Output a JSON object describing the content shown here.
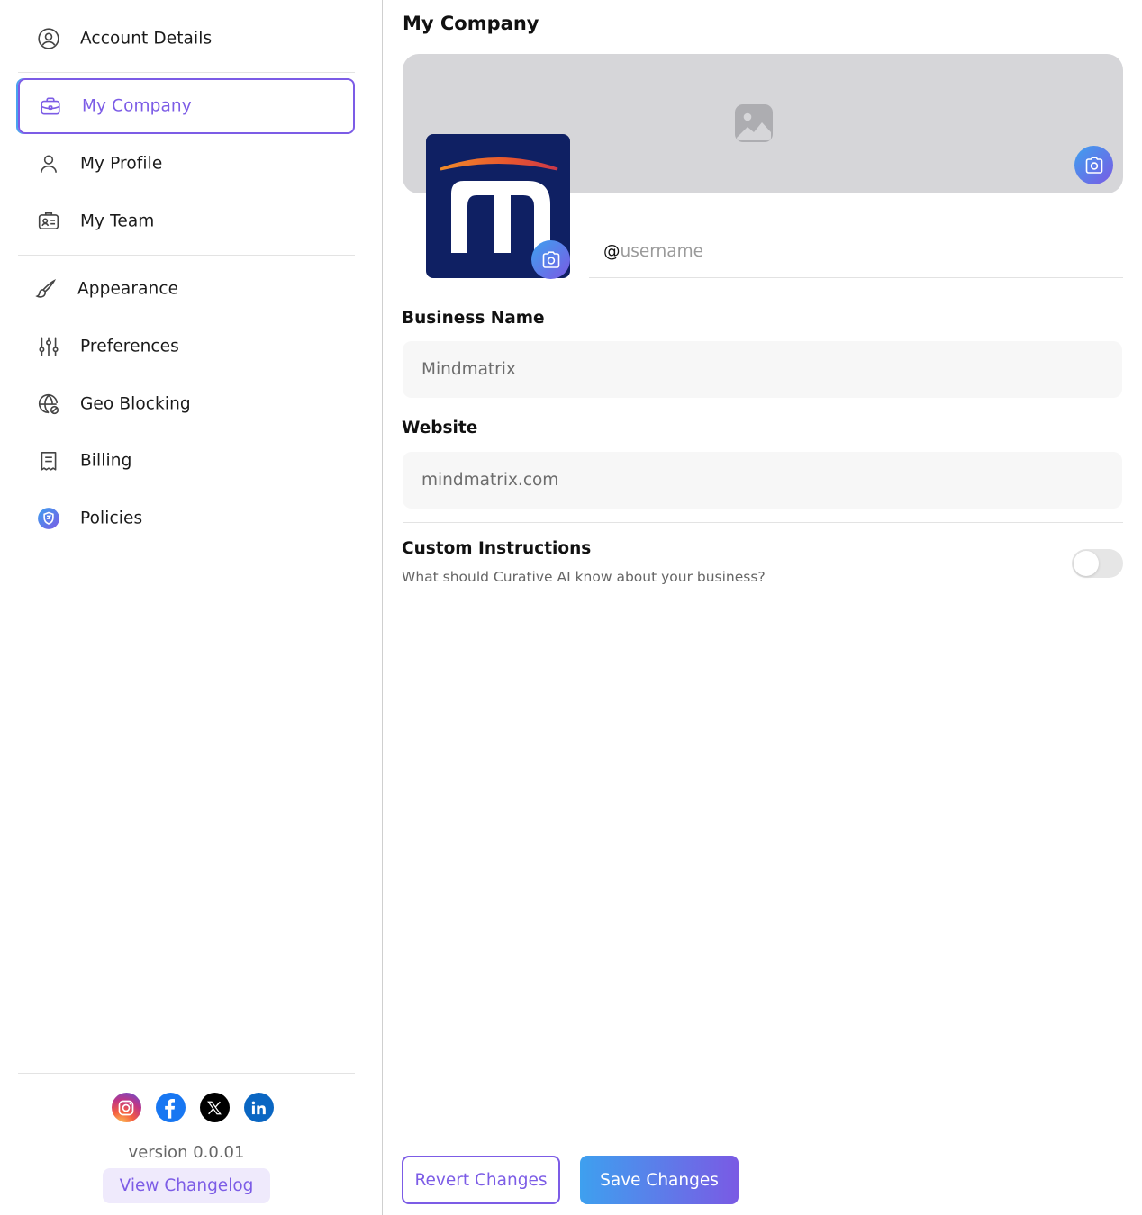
{
  "sidebar": {
    "items": [
      {
        "label": "Account Details",
        "icon": "user-circle-icon"
      },
      {
        "label": "My Company",
        "icon": "briefcase-icon",
        "active": true
      },
      {
        "label": "My Profile",
        "icon": "user-icon"
      },
      {
        "label": "My Team",
        "icon": "id-card-icon"
      },
      {
        "label": "Appearance",
        "icon": "brush-icon"
      },
      {
        "label": "Preferences",
        "icon": "sliders-icon"
      },
      {
        "label": "Geo Blocking",
        "icon": "globe-block-icon"
      },
      {
        "label": "Billing",
        "icon": "receipt-icon"
      },
      {
        "label": "Policies",
        "icon": "shield-badge-icon"
      }
    ],
    "social": [
      "instagram-icon",
      "facebook-icon",
      "x-icon",
      "linkedin-icon"
    ],
    "version": "version 0.0.01",
    "changelog_label": "View Changelog"
  },
  "main": {
    "title": "My Company",
    "username": {
      "prefix": "@",
      "placeholder": "username"
    },
    "business_name": {
      "label": "Business Name",
      "value": "Mindmatrix"
    },
    "website": {
      "label": "Website",
      "value": "mindmatrix.com"
    },
    "custom_instructions": {
      "label": "Custom Instructions",
      "description": "What should Curative AI know about your business?",
      "enabled": false
    },
    "revert_label": "Revert Changes",
    "save_label": "Save Changes"
  },
  "colors": {
    "accent": "#7c5ce6",
    "gradient_start": "#3ea0ef",
    "gradient_end": "#7a5ae4",
    "logo_bg": "#0f2063",
    "banner_bg": "#d6d6d9"
  }
}
